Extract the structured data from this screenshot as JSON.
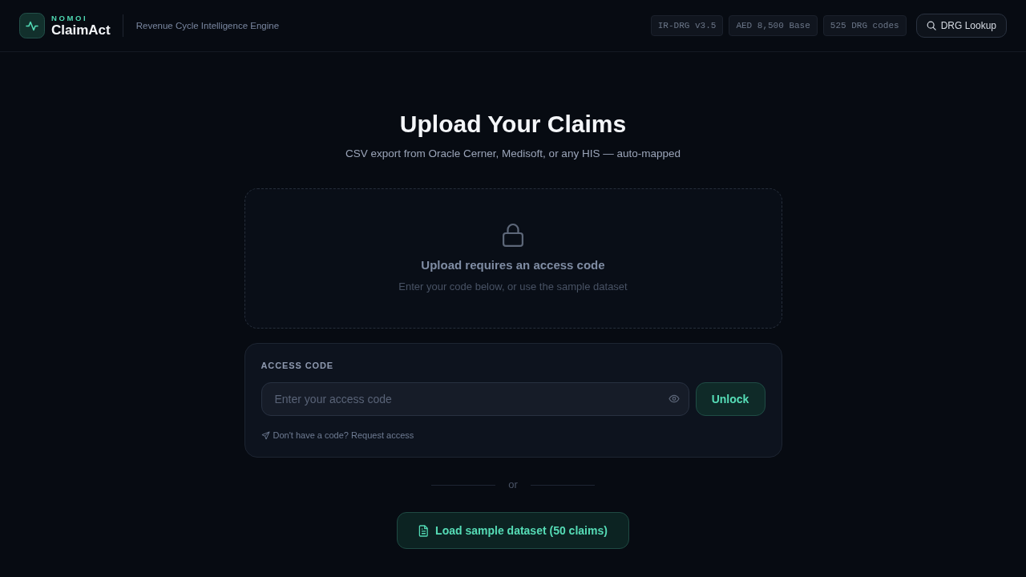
{
  "header": {
    "brand_overline": "NOMOI",
    "brand_name": "ClaimAct",
    "tagline": "Revenue Cycle Intelligence Engine",
    "badges": [
      "IR-DRG v3.5",
      "AED 8,500 Base",
      "525 DRG codes"
    ],
    "lookup_button": "DRG Lookup"
  },
  "upload": {
    "title": "Upload Your Claims",
    "subtitle": "CSV export from Oracle Cerner, Medisoft, or any HIS — auto-mapped",
    "dropzone": {
      "heading": "Upload requires an access code",
      "hint": "Enter your code below, or use the sample dataset"
    }
  },
  "access": {
    "label": "ACCESS CODE",
    "field": {
      "placeholder": "Enter your access code"
    },
    "unlock_button": "Unlock",
    "request_link": "Don't have a code? Request access"
  },
  "divider": "or",
  "sample_button": "Load sample dataset (50 claims)"
}
